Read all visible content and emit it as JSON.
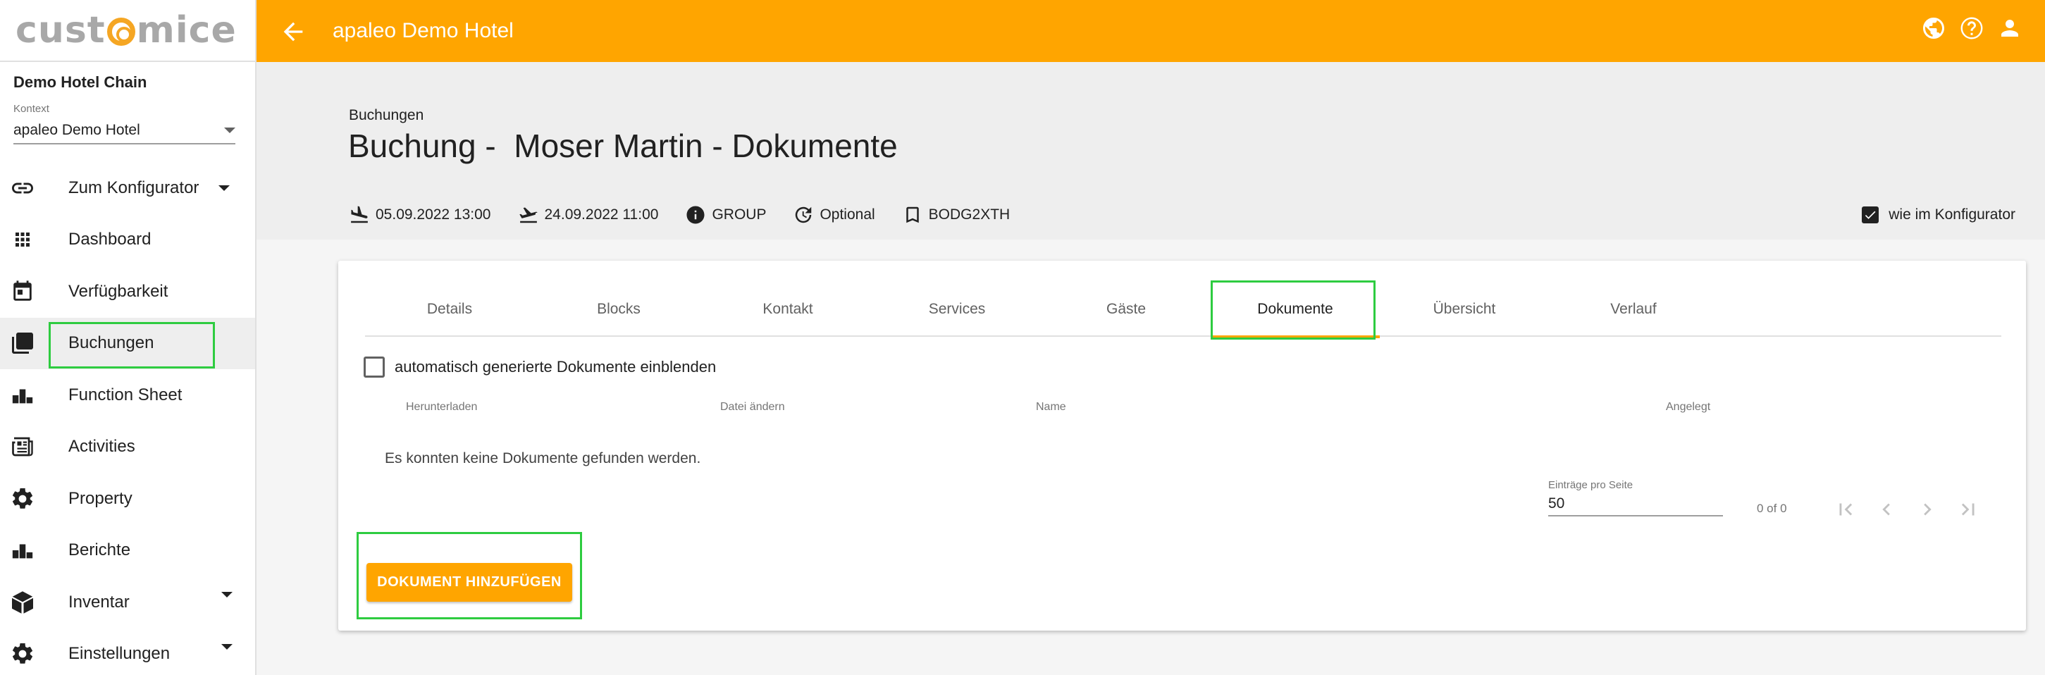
{
  "brand": {
    "logo_text_left": "cust",
    "logo_text_right": "mice",
    "accent_color": "#ffa500",
    "highlight_color": "#2ecc40"
  },
  "sidebar": {
    "chain_name": "Demo Hotel Chain",
    "context_label": "Kontext",
    "context_value": "apaleo Demo Hotel",
    "items": [
      {
        "label": "Zum Konfigurator",
        "icon": "link-icon",
        "has_caret": true
      },
      {
        "label": "Dashboard",
        "icon": "apps-grid-icon"
      },
      {
        "label": "Verfügbarkeit",
        "icon": "calendar-icon"
      },
      {
        "label": "Buchungen",
        "icon": "library-icon",
        "active": true
      },
      {
        "label": "Function Sheet",
        "icon": "bar-chart-icon"
      },
      {
        "label": "Activities",
        "icon": "newspaper-icon"
      },
      {
        "label": "Property",
        "icon": "gear-icon"
      },
      {
        "label": "Berichte",
        "icon": "bar-chart-icon"
      },
      {
        "label": "Inventar",
        "icon": "cube-icon",
        "has_caret": true
      },
      {
        "label": "Einstellungen",
        "icon": "gear-icon",
        "has_caret": true
      }
    ]
  },
  "topbar": {
    "title": "apaleo Demo Hotel",
    "icons": [
      "language-icon",
      "help-icon",
      "account-icon"
    ]
  },
  "header": {
    "breadcrumb": "Buchungen",
    "title": "Buchung -  Moser Martin - Dokumente",
    "arrival": "05.09.2022 13:00",
    "departure": "24.09.2022 11:00",
    "type": "GROUP",
    "status": "Optional",
    "code": "BODG2XTH",
    "configurator_checkbox_label": "wie im Konfigurator",
    "configurator_checked": true
  },
  "tabs": [
    {
      "label": "Details"
    },
    {
      "label": "Blocks"
    },
    {
      "label": "Kontakt"
    },
    {
      "label": "Services"
    },
    {
      "label": "Gäste"
    },
    {
      "label": "Dokumente",
      "active": true
    },
    {
      "label": "Übersicht"
    },
    {
      "label": "Verlauf"
    }
  ],
  "documents": {
    "auto_docs_label": "automatisch generierte Dokumente einblenden",
    "auto_docs_checked": false,
    "columns": [
      "Herunterladen",
      "Datei ändern",
      "Name",
      "Angelegt"
    ],
    "empty_message": "Es konnten keine Dokumente gefunden werden.",
    "paging": {
      "label": "Einträge pro Seite",
      "page_size": "50",
      "range": "0 of 0"
    },
    "add_button": "DOKUMENT HINZUFÜGEN"
  }
}
